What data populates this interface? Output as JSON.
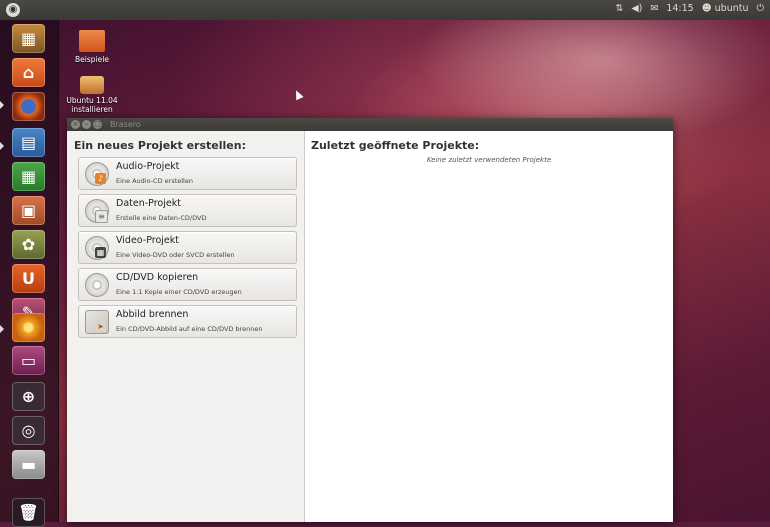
{
  "panel": {
    "time": "14:15",
    "user": "ubuntu",
    "network_icon": "network-arrows-icon",
    "sound_icon": "speaker-icon",
    "mail_icon": "envelope-icon"
  },
  "desktop": {
    "icons": [
      {
        "label": "Beispiele",
        "icon": "folder-icon"
      },
      {
        "label_line1": "Ubuntu 11.04",
        "label_line2": "installieren",
        "icon": "installer-icon"
      }
    ]
  },
  "launcher": {
    "items": [
      "dash-icon",
      "home-folder-icon",
      "firefox-icon",
      "writer-icon",
      "calc-icon",
      "impress-icon",
      "photos-icon",
      "software-center-icon",
      "settings-icon",
      "brasero-icon",
      "workspaces-icon",
      "zoom-icon",
      "search-icon",
      "drive-icon",
      "trash-icon"
    ]
  },
  "window": {
    "title": "Brasero",
    "left_heading": "Ein neues Projekt erstellen:",
    "right_heading": "Zuletzt geöffnete Projekte:",
    "empty_message": "Keine zuletzt verwendeten Projekte",
    "projects": [
      {
        "title": "Audio-Projekt",
        "subtitle": "Eine Audio-CD erstellen",
        "icon": "audio-disc-icon"
      },
      {
        "title": "Daten-Projekt",
        "subtitle": "Erstelle eine Daten-CD/DVD",
        "icon": "data-disc-icon"
      },
      {
        "title": "Video-Projekt",
        "subtitle": "Eine Video-DVD oder SVCD erstellen",
        "icon": "video-disc-icon"
      },
      {
        "title": "CD/DVD kopieren",
        "subtitle": "Eine 1:1 Kopie einer CD/DVD erzeugen",
        "icon": "copy-disc-icon"
      },
      {
        "title": "Abbild brennen",
        "subtitle": "Ein CD/DVD-Abbild auf eine CD/DVD brennen",
        "icon": "burn-image-icon"
      }
    ]
  },
  "colors": {
    "accent": "#dd4814",
    "panel": "#3c3b37"
  }
}
